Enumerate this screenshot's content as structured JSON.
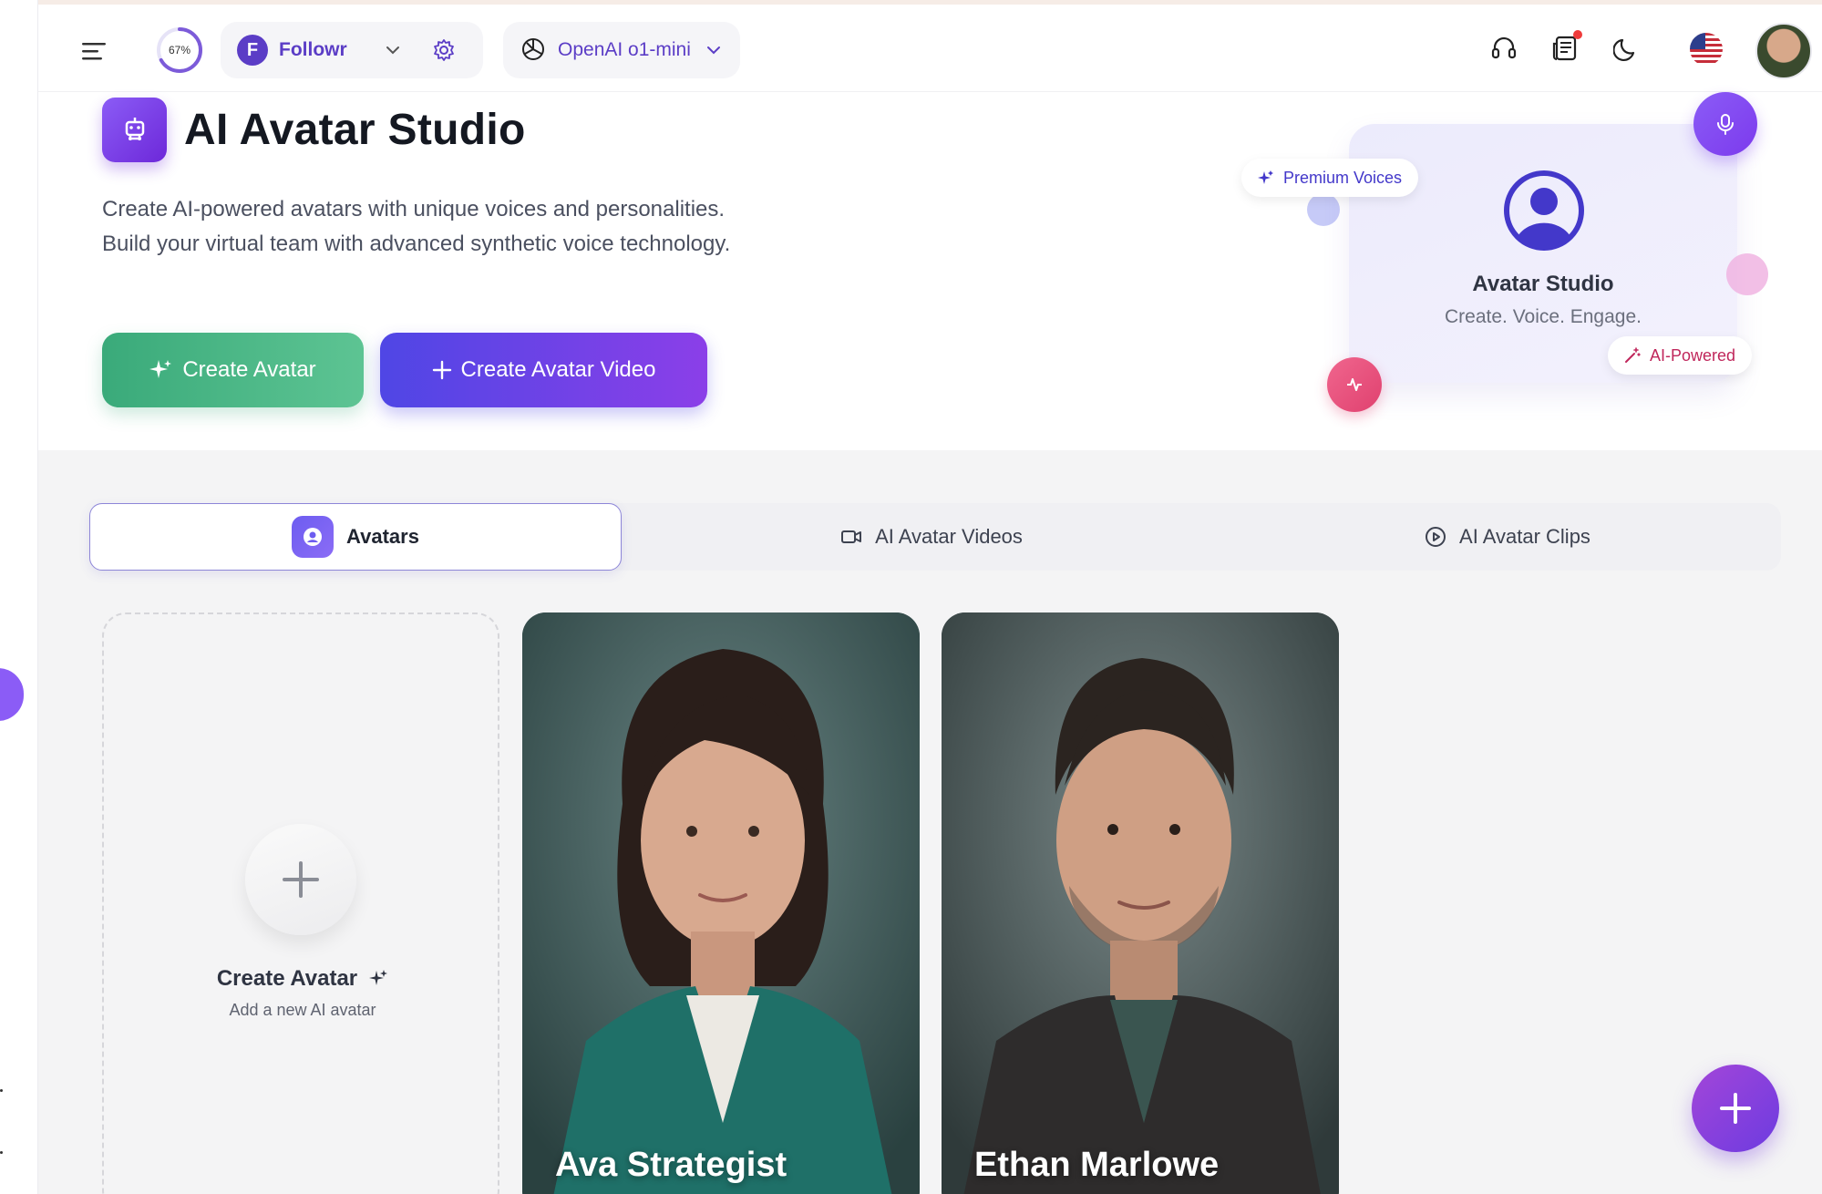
{
  "header": {
    "progress_label": "67%",
    "progress_value": 0.67,
    "workspace": {
      "initial": "F",
      "name": "Followr"
    },
    "model": {
      "name": "OpenAI o1-mini"
    },
    "icons": [
      "menu-icon",
      "gear-icon",
      "openai-icon",
      "headset-icon",
      "news-icon",
      "moon-icon",
      "us-flag-icon"
    ]
  },
  "hero": {
    "title": "AI Avatar Studio",
    "description": "Create AI-powered avatars with unique voices and personalities. Build your virtual team with advanced synthetic voice technology.",
    "create_avatar_label": "Create Avatar",
    "create_video_label": "Create Avatar Video",
    "card": {
      "title": "Avatar Studio",
      "subtitle": "Create. Voice. Engage.",
      "chip_voices": "Premium Voices",
      "chip_ai": "AI-Powered"
    }
  },
  "tabs": [
    {
      "label": "Avatars",
      "active": true
    },
    {
      "label": "AI Avatar Videos",
      "active": false
    },
    {
      "label": "AI Avatar Clips",
      "active": false
    }
  ],
  "create_card": {
    "title": "Create Avatar",
    "subtitle": "Add a new AI avatar"
  },
  "avatars": [
    {
      "name": "Ava Strategist"
    },
    {
      "name": "Ethan Marlowe"
    }
  ],
  "colors": {
    "accent": "#5b3dc6",
    "green": "#3aaa7a",
    "purple": "#6d28d9",
    "pink": "#e0416f"
  }
}
